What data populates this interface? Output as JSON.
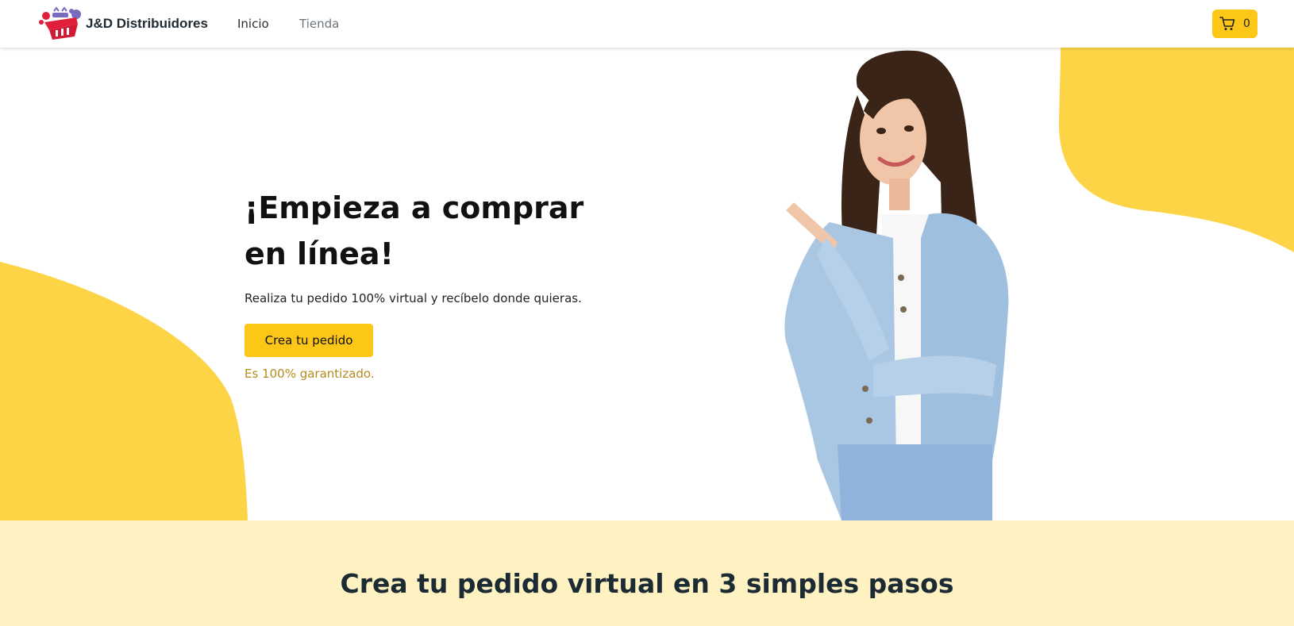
{
  "navbar": {
    "brand_name": "J&D Distribuidores",
    "links": [
      {
        "label": "Inicio",
        "active": true
      },
      {
        "label": "Tienda",
        "active": false
      }
    ],
    "cart": {
      "count": "0",
      "icon": "cart-icon"
    }
  },
  "hero": {
    "title": "¡Empieza a comprar en línea!",
    "subtitle": "Realiza tu pedido 100% virtual y recíbelo donde quieras.",
    "cta_label": "Crea tu pedido",
    "note": "Es 100% garantizado."
  },
  "steps": {
    "title": "Crea tu pedido virtual en 3 simples pasos"
  },
  "colors": {
    "accent": "#fdc718",
    "blob": "#fdd445",
    "steps_bg": "#fef1c2",
    "note": "#b58b1e"
  }
}
